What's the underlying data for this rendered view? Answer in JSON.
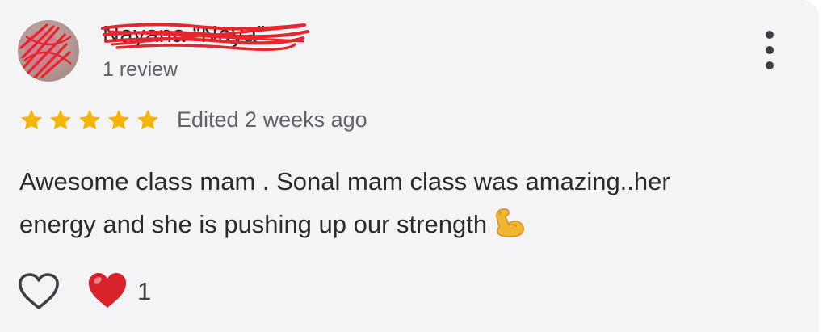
{
  "reviewer": {
    "name": "Nayana “Naya”",
    "review_count": "1 review"
  },
  "rating": {
    "stars": 5,
    "max_stars": 5,
    "star_color": "#f5b400",
    "timestamp": "Edited 2 weeks ago"
  },
  "review": {
    "line1": "Awesome class mam . Sonal mam class was amazing..her",
    "line2": "energy and she is pushing up our strength",
    "emoji_icon": "flexed-biceps-icon"
  },
  "actions": {
    "like_icon": "heart-outline-icon",
    "reaction_icon": "red-heart-icon",
    "reaction_count": "1",
    "menu_icon": "vertical-dots-icon"
  },
  "colors": {
    "card_bg": "#f4f4f7",
    "text_primary": "#2b2b2b",
    "text_secondary": "#5f6368",
    "redaction": "#e8242c",
    "heart_red": "#d8232a"
  }
}
